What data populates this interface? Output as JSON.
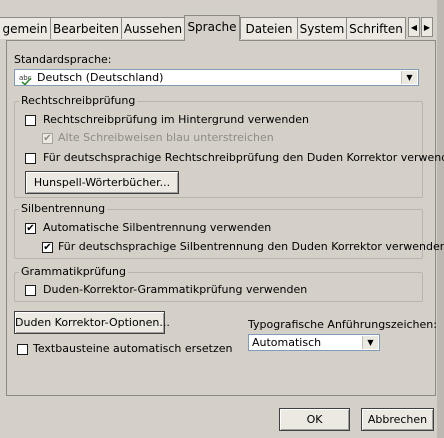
{
  "tabs": [
    {
      "label": "gemein",
      "active": false
    },
    {
      "label": "Bearbeiten",
      "active": false
    },
    {
      "label": "Aussehen",
      "active": false
    },
    {
      "label": "Sprache",
      "active": true
    },
    {
      "label": "Dateien",
      "active": false
    },
    {
      "label": "System",
      "active": false
    },
    {
      "label": "Schriften",
      "active": false
    }
  ],
  "language": {
    "label": "Standardsprache:",
    "value": "Deutsch (Deutschland)"
  },
  "spellcheck": {
    "title": "Rechtschreibprüfung",
    "background_label": "Rechtschreibprüfung im Hintergrund verwenden",
    "background_checked": false,
    "alt_label": "Alte Schreibweisen blau unterstreichen",
    "alt_checked": true,
    "alt_disabled": true,
    "duden_label": "Für deutschsprachige Rechtschreibprüfung den Duden Korrektor verwenden",
    "duden_checked": false,
    "hunspell_button": "Hunspell-Wörterbücher..."
  },
  "hyphenation": {
    "title": "Silbentrennung",
    "auto_label": "Automatische Silbentrennung verwenden",
    "auto_checked": true,
    "duden_label": "Für deutschsprachige Silbentrennung den Duden Korrektor verwenden",
    "duden_checked": true
  },
  "grammar": {
    "title": "Grammatikprüfung",
    "duden_label": "Duden-Korrektor-Grammatikprüfung verwenden",
    "duden_checked": false
  },
  "duden_options_button": "Duden Korrektor-Optionen...",
  "textblocks": {
    "label": "Textbausteine automatisch ersetzen",
    "checked": false
  },
  "quotes": {
    "label": "Typografische Anführungszeichen:",
    "value": "Automatisch"
  },
  "footer": {
    "ok": "OK",
    "cancel": "Abbrechen"
  },
  "glyphs": {
    "check": "✔",
    "arrow_down": "▼",
    "arrow_left": "◀",
    "arrow_right": "▶"
  }
}
